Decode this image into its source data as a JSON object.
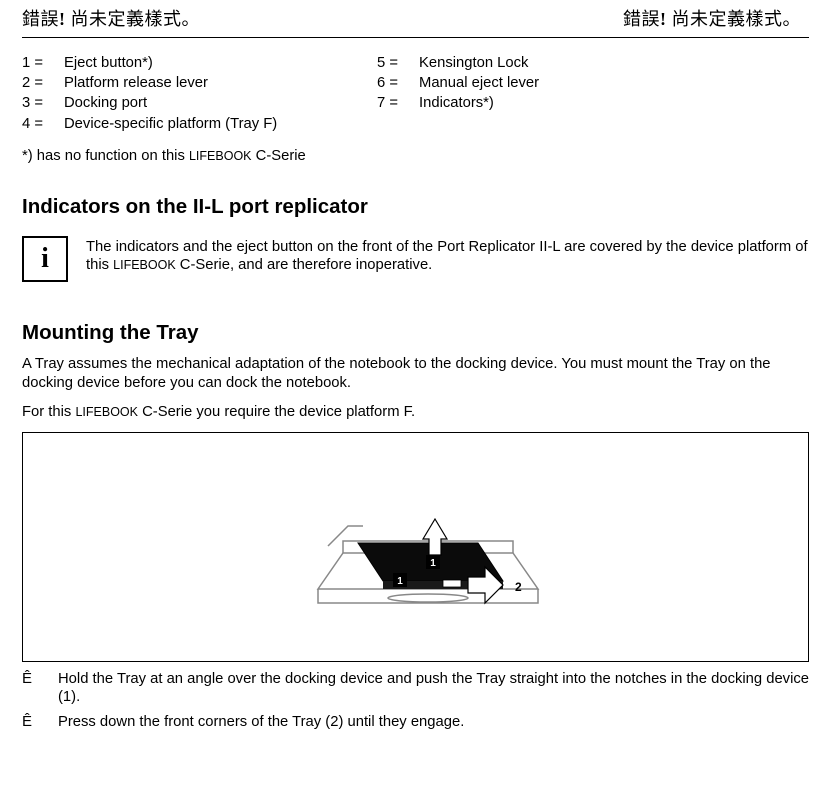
{
  "header": {
    "left_pre": "錯誤",
    "left_bang": "!",
    "left_rest": " 尚未定義樣式。",
    "right_pre": "錯誤",
    "right_bang": "!",
    "right_rest": " 尚未定義樣式。"
  },
  "legend": {
    "col1": [
      {
        "n": "1 =",
        "t": "Eject button*)"
      },
      {
        "n": "2 =",
        "t": "Platform release lever"
      },
      {
        "n": "3 =",
        "t": "Docking port"
      },
      {
        "n": "4 =",
        "t": "Device-specific platform (Tray F)"
      }
    ],
    "col2": [
      {
        "n": "5 =",
        "t": "Kensington Lock"
      },
      {
        "n": "6 =",
        "t": "Manual eject lever"
      },
      {
        "n": "7 =",
        "t": "Indicators*)"
      }
    ]
  },
  "footnote_pre": "*) has no function on this ",
  "footnote_brand": "LIFEBOOK",
  "footnote_post": " C-Serie",
  "section_indicators": "Indicators on the II-L port replicator",
  "info_icon": "i",
  "info_text_pre": "The indicators and the eject button on the front of the Port Replicator II-L are covered by the device platform of this ",
  "info_text_brand": "LIFEBOOK",
  "info_text_post": " C-Serie, and are therefore inoperative.",
  "section_mount": "Mounting the Tray",
  "mount_para1": "A Tray assumes the mechanical adaptation of the notebook to the docking device. You must mount the Tray on the docking device before you can dock the notebook.",
  "mount_para2_pre": "For this ",
  "mount_para2_brand": "LIFEBOOK",
  "mount_para2_post": " C-Serie you require the device platform F.",
  "figure": {
    "label1a": "1",
    "label1b": "1",
    "label2": "2"
  },
  "steps": [
    {
      "bullet": "Ê",
      "text": "Hold the Tray at an angle over the docking device and push the Tray straight into the notches in the docking device (1)."
    },
    {
      "bullet": "Ê",
      "text": "Press down the front corners of the Tray (2) until they engage."
    }
  ]
}
